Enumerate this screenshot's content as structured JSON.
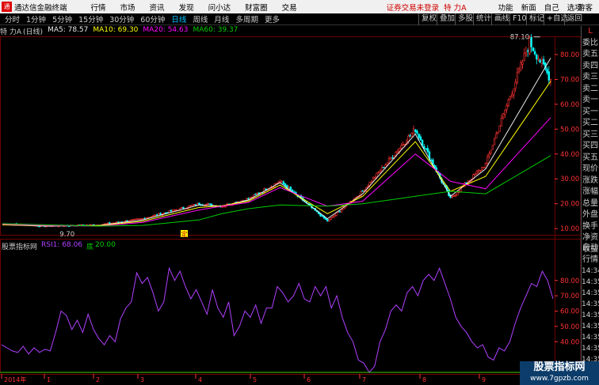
{
  "app": {
    "logo_char": "通",
    "name": "通达信金融终端",
    "menus": [
      "行情",
      "市场",
      "资讯",
      "发现",
      "问小达",
      "财富圈",
      "交易"
    ],
    "status": "证券交易未登录",
    "stock_name": "特 力A",
    "right_menus": [
      "功能",
      "新面",
      "自己",
      "选项"
    ],
    "guest": "游客"
  },
  "toolbar": {
    "periods": [
      "分时",
      "1分钟",
      "5分钟",
      "15分钟",
      "30分钟",
      "60分钟",
      "日线",
      "周线",
      "月线",
      "多周期",
      "更多"
    ],
    "active_index": 6,
    "right_tools": [
      "复权",
      "叠加",
      "多股",
      "统计",
      "画线",
      "F10",
      "标记",
      "+自选",
      "返回"
    ]
  },
  "ma_header": {
    "stock": "特 力A",
    "period": "(日线)",
    "ma5": "MA5: 78.57",
    "ma10": "MA10: 69.30",
    "ma20": "MA20: 54.63",
    "ma60": "MA60: 39.37"
  },
  "colors": {
    "ma5": "#e8e8e8",
    "ma10": "#ffff00",
    "ma20": "#ff00ff",
    "ma60": "#00cc00",
    "up": "#ff3232",
    "down": "#00ffff",
    "rsi": "#b040ff",
    "grid": "#700000",
    "axis_text": "#ff3232"
  },
  "right_panel": {
    "top_labels": [
      "L",
      "委比",
      "卖五",
      "卖四",
      "卖三",
      "卖二",
      "卖一",
      "买一",
      "买二",
      "买三",
      "买四",
      "买五",
      "现价",
      "涨跌",
      "涨幅",
      "总量",
      "外盘",
      "换手",
      "净资",
      "收益"
    ],
    "mid_labels": [
      "自动",
      "行情"
    ],
    "times": [
      "14:34",
      "14:35",
      "14:35",
      "14:35",
      "14:35",
      "14:35",
      "14:35",
      "14:35",
      "14:35",
      "14:35"
    ]
  },
  "rsi_header": {
    "name": "股票指标网",
    "rsi1": "RSI1: 68.06",
    "bottom_label": "底",
    "bottom_value": "20.00"
  },
  "chart_data": [
    {
      "type": "candlestick",
      "title": "特 力A (日线)",
      "y_ticks": [
        10.0,
        20.0,
        30.0,
        40.0,
        50.0,
        60.0,
        70.0,
        80.0
      ],
      "ylim": [
        7.5,
        87
      ],
      "annotations": [
        {
          "label": "87.10",
          "kind": "high"
        },
        {
          "label": "9.70",
          "kind": "low"
        },
        {
          "label": "定",
          "kind": "marker"
        }
      ],
      "x_months": [
        "2014年",
        "1",
        "2",
        "3",
        "4",
        "5",
        "6",
        "7",
        "8",
        "9"
      ],
      "close_approx": [
        12.0,
        11.0,
        11.5,
        14.0,
        20.0,
        19.0,
        22.0,
        29.0,
        13.0,
        25.0,
        50.0,
        22.0,
        36.0,
        85.0,
        70.0
      ],
      "series": [
        {
          "name": "MA5",
          "values": [
            11.5,
            11.0,
            11.3,
            13.5,
            19.5,
            19.0,
            21.5,
            28.5,
            14.0,
            24.0,
            48.0,
            23.0,
            34.0,
            78.57
          ]
        },
        {
          "name": "MA10",
          "values": [
            11.5,
            11.2,
            11.2,
            13.0,
            18.5,
            19.2,
            21.0,
            27.5,
            16.0,
            23.0,
            45.0,
            25.0,
            31.0,
            69.3
          ]
        },
        {
          "name": "MA20",
          "values": [
            11.8,
            11.3,
            11.0,
            12.5,
            17.5,
            19.0,
            20.5,
            26.5,
            19.0,
            21.0,
            40.0,
            29.0,
            26.0,
            54.63
          ]
        },
        {
          "name": "MA60",
          "values": [
            12.0,
            11.5,
            11.0,
            11.3,
            13.5,
            16.0,
            18.0,
            19.5,
            19.0,
            20.0,
            23.0,
            25.0,
            24.0,
            39.37
          ]
        }
      ]
    },
    {
      "type": "line",
      "title": "RSI",
      "y_ticks": [
        40.0,
        50.0,
        60.0,
        70.0,
        80.0
      ],
      "ylim": [
        20,
        100
      ],
      "series": [
        {
          "name": "RSI1",
          "values": [
            38,
            36,
            34,
            33,
            37,
            32,
            36,
            33,
            35,
            34,
            46,
            60,
            57,
            48,
            54,
            46,
            58,
            48,
            42,
            38,
            44,
            40,
            55,
            62,
            66,
            85,
            78,
            82,
            72,
            60,
            66,
            88,
            80,
            86,
            76,
            68,
            74,
            66,
            58,
            74,
            62,
            56,
            66,
            44,
            50,
            60,
            56,
            64,
            52,
            62,
            62,
            76,
            72,
            66,
            70,
            78,
            68,
            66,
            76,
            70,
            76,
            62,
            70,
            56,
            46,
            40,
            28,
            26,
            20,
            24,
            40,
            48,
            60,
            64,
            60,
            72,
            76,
            70,
            80,
            84,
            80,
            88,
            78,
            68,
            56,
            50,
            46,
            40,
            36,
            38,
            30,
            28,
            36,
            34,
            40,
            52,
            62,
            70,
            78,
            76,
            86,
            80,
            68
          ]
        }
      ],
      "bottom_line": 20.0
    }
  ],
  "watermark": {
    "line1": "股票指标网",
    "line2": "www.7gpzb.com"
  }
}
